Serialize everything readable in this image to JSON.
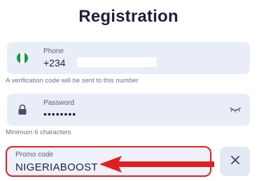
{
  "header": {
    "title": "Registration"
  },
  "phone": {
    "label": "Phone",
    "country_code": "+234",
    "hint": "A verification code will be sent to this number",
    "flag_icon": "nigeria-flag-icon"
  },
  "password": {
    "label": "Password",
    "value": "••••••••",
    "hint": "Minimum 6 characters",
    "lock_icon": "lock-icon",
    "toggle_icon": "eye-closed-icon"
  },
  "promo": {
    "label": "Promo code",
    "value": "NIGERIABOOST",
    "highlight_color": "#e02020"
  },
  "clear_button": {
    "icon": "close-icon"
  }
}
